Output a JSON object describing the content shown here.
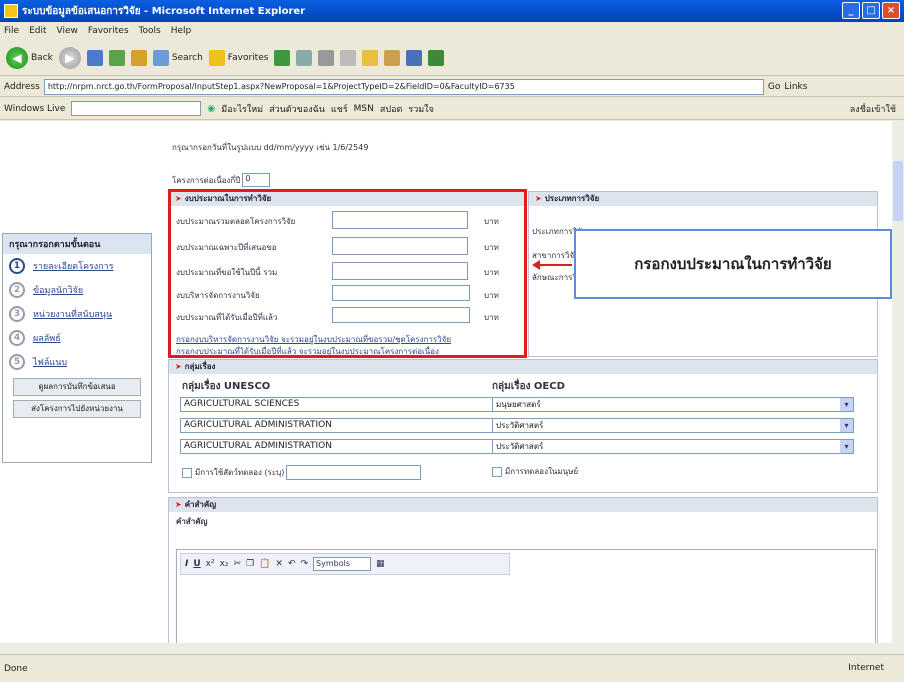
{
  "window": {
    "title": "ระบบข้อมูลข้อเสนอการวิจัย - Microsoft Internet Explorer"
  },
  "menu": [
    "File",
    "Edit",
    "View",
    "Favorites",
    "Tools",
    "Help"
  ],
  "toolbar": {
    "back": "Back",
    "search": "Search",
    "favorites": "Favorites"
  },
  "address": {
    "label": "Address",
    "url": "http://nrpm.nrct.go.th/FormProposal/InputStep1.aspx?NewProposal=1&ProjectTypeID=2&FieldID=0&FacultyID=6735",
    "go": "Go",
    "links": "Links"
  },
  "windowslive": {
    "label": "Windows Live",
    "items": [
      "มีอะไรใหม่",
      "ส่วนตัวของฉัน",
      "แชร์",
      "MSN",
      "สปอต",
      "รวมใจ"
    ],
    "signin": "ลงชื่อเข้าใช้"
  },
  "sidebar": {
    "header": "กรุณากรอกตามขั้นตอน",
    "steps": [
      {
        "n": "1",
        "label": "รายละเอียดโครงการ",
        "active": true
      },
      {
        "n": "2",
        "label": "ข้อมูลนักวิจัย",
        "active": false
      },
      {
        "n": "3",
        "label": "หน่วยงานที่สนับสนุน",
        "active": false
      },
      {
        "n": "4",
        "label": "ผลลัพธ์",
        "active": false
      },
      {
        "n": "5",
        "label": "ไฟล์แนบ",
        "active": false
      }
    ],
    "btn1": "ดูผลการบันทึกข้อเสนอ",
    "btn2": "ส่งโครงการไปยังหน่วยงาน"
  },
  "form": {
    "dateNote": "กรุณากรอกวันที่ในรูปแบบ dd/mm/yyyy เช่น 1/6/2549",
    "yearsLabel": "โครงการต่อเนื่องกี่ปี",
    "yearsValue": "0",
    "budgetTitle": "งบประมาณในการทำวิจัย",
    "budgetRows": [
      "งบประมาณรวมตลอดโครงการวิจัย",
      "งบประมาณเฉพาะปีที่เสนอขอ",
      "งบประมาณที่ขอใช้ในปีนี้ รวม",
      "งบบริหารจัดการงานวิจัย",
      "งบประมาณที่ได้รับเมื่อปีที่แล้ว"
    ],
    "unit": "บาท",
    "note1": "กรอกงบบริหารจัดการงานวิจัย จะรวมอยู่ในงบประมาณที่ขอรวม/ชุดโครงการวิจัย",
    "note2": "กรอกงบประมาณที่ได้รับเมื่อปีที่แล้ว จะรวมอยู่ในงบประมาณโครงการต่อเนื่อง",
    "typeTitle": "ประเภทการวิจัย",
    "typeLabels": [
      "ประเภทการวิจัย",
      "สาขาการวิจัย",
      "ลักษณะการวิจัย"
    ],
    "subjTitle": "กลุ่มเรื่อง",
    "unescoLabel": "กลุ่มเรื่อง UNESCO",
    "oecdLabel": "กลุ่มเรื่อง OECD",
    "unesco": [
      "AGRICULTURAL SCIENCES",
      "AGRICULTURAL ADMINISTRATION",
      "AGRICULTURAL ADMINISTRATION"
    ],
    "oecd": [
      "มนุษยศาสตร์",
      "ประวัติศาสตร์",
      "ประวัติศาสตร์"
    ],
    "check1": "มีการใช้สัตว์ทดลอง (ระบุ)",
    "check2": "มีการทดลองในมนุษย์",
    "keywordTitle": "คำสำคัญ",
    "keywordLabel": "คำสำคัญ"
  },
  "editor": {
    "symbol": "Symbols"
  },
  "callout": "กรอกงบประมาณในการทำวิจัย",
  "status": {
    "left": "Done",
    "zone": "Internet"
  }
}
